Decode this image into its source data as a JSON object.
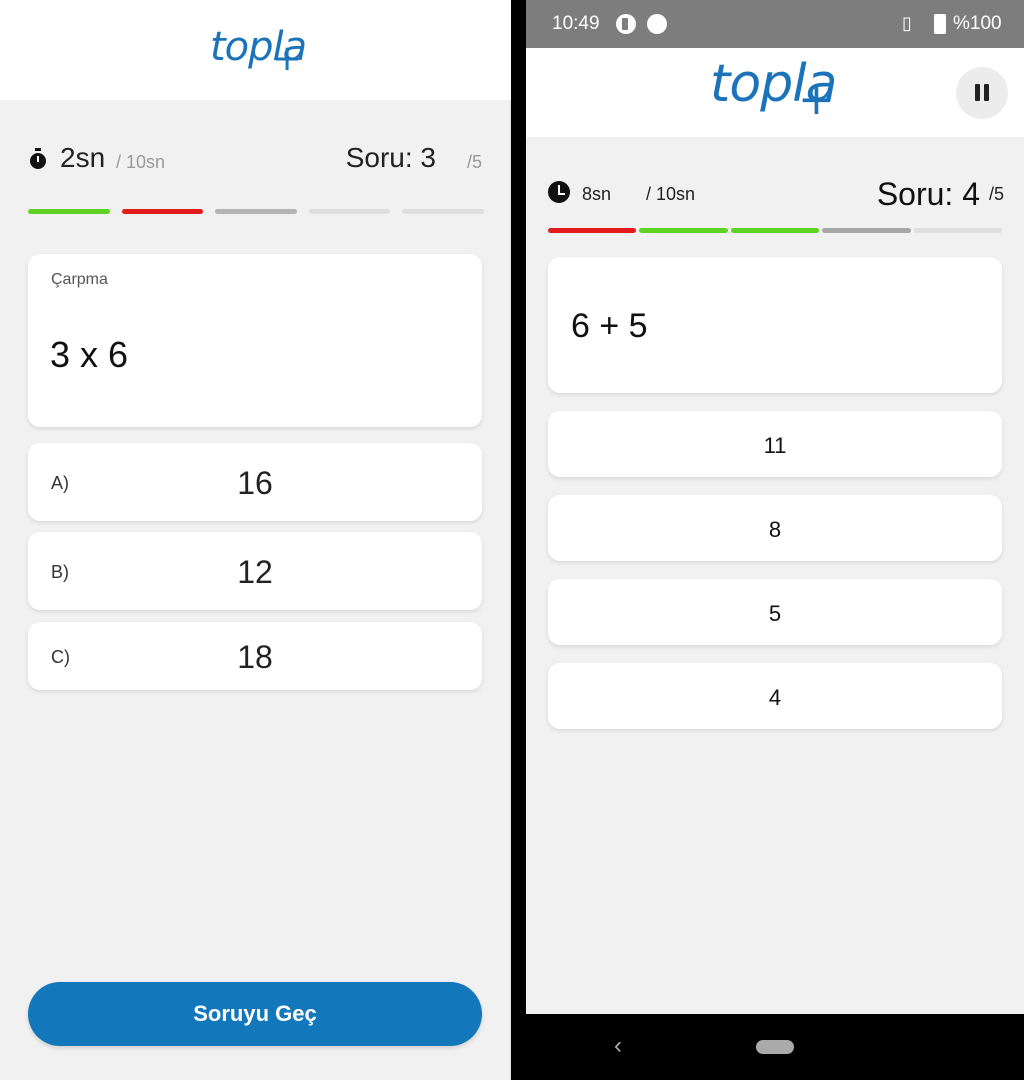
{
  "left": {
    "logo": {
      "text": "topla",
      "plus": "+"
    },
    "timer": {
      "value": "2sn",
      "max": "/ 10sn"
    },
    "question_counter": {
      "label": "Soru: 3",
      "total": "/5"
    },
    "progress": [
      "#5ed324",
      "#e21c1c",
      "#b4b4b4",
      "#dedede",
      "#dedede"
    ],
    "question": {
      "category": "Çarpma",
      "expression": "3 x 6"
    },
    "options": [
      {
        "letter": "A)",
        "value": "16"
      },
      {
        "letter": "B)",
        "value": "12"
      },
      {
        "letter": "C)",
        "value": "18"
      }
    ],
    "skip_button": "Soruyu Geç"
  },
  "right": {
    "status_bar": {
      "time": "10:49",
      "battery": "%100"
    },
    "logo": {
      "text": "topla",
      "plus": "+"
    },
    "timer": {
      "value": "8sn",
      "max": "/ 10sn"
    },
    "question_counter": {
      "label": "Soru: 4",
      "total": "/5"
    },
    "progress": [
      "#e21c1c",
      "#5ed324",
      "#5ed324",
      "#a7a7a7",
      "#dedede"
    ],
    "question": {
      "expression": "6 + 5"
    },
    "options": [
      {
        "value": "11"
      },
      {
        "value": "8"
      },
      {
        "value": "5"
      },
      {
        "value": "4"
      }
    ],
    "icons": {
      "stopwatch": "stopwatch-icon",
      "clock": "clock-icon",
      "pause": "pause-icon",
      "back": "back-icon",
      "home": "home-pill-icon"
    }
  }
}
